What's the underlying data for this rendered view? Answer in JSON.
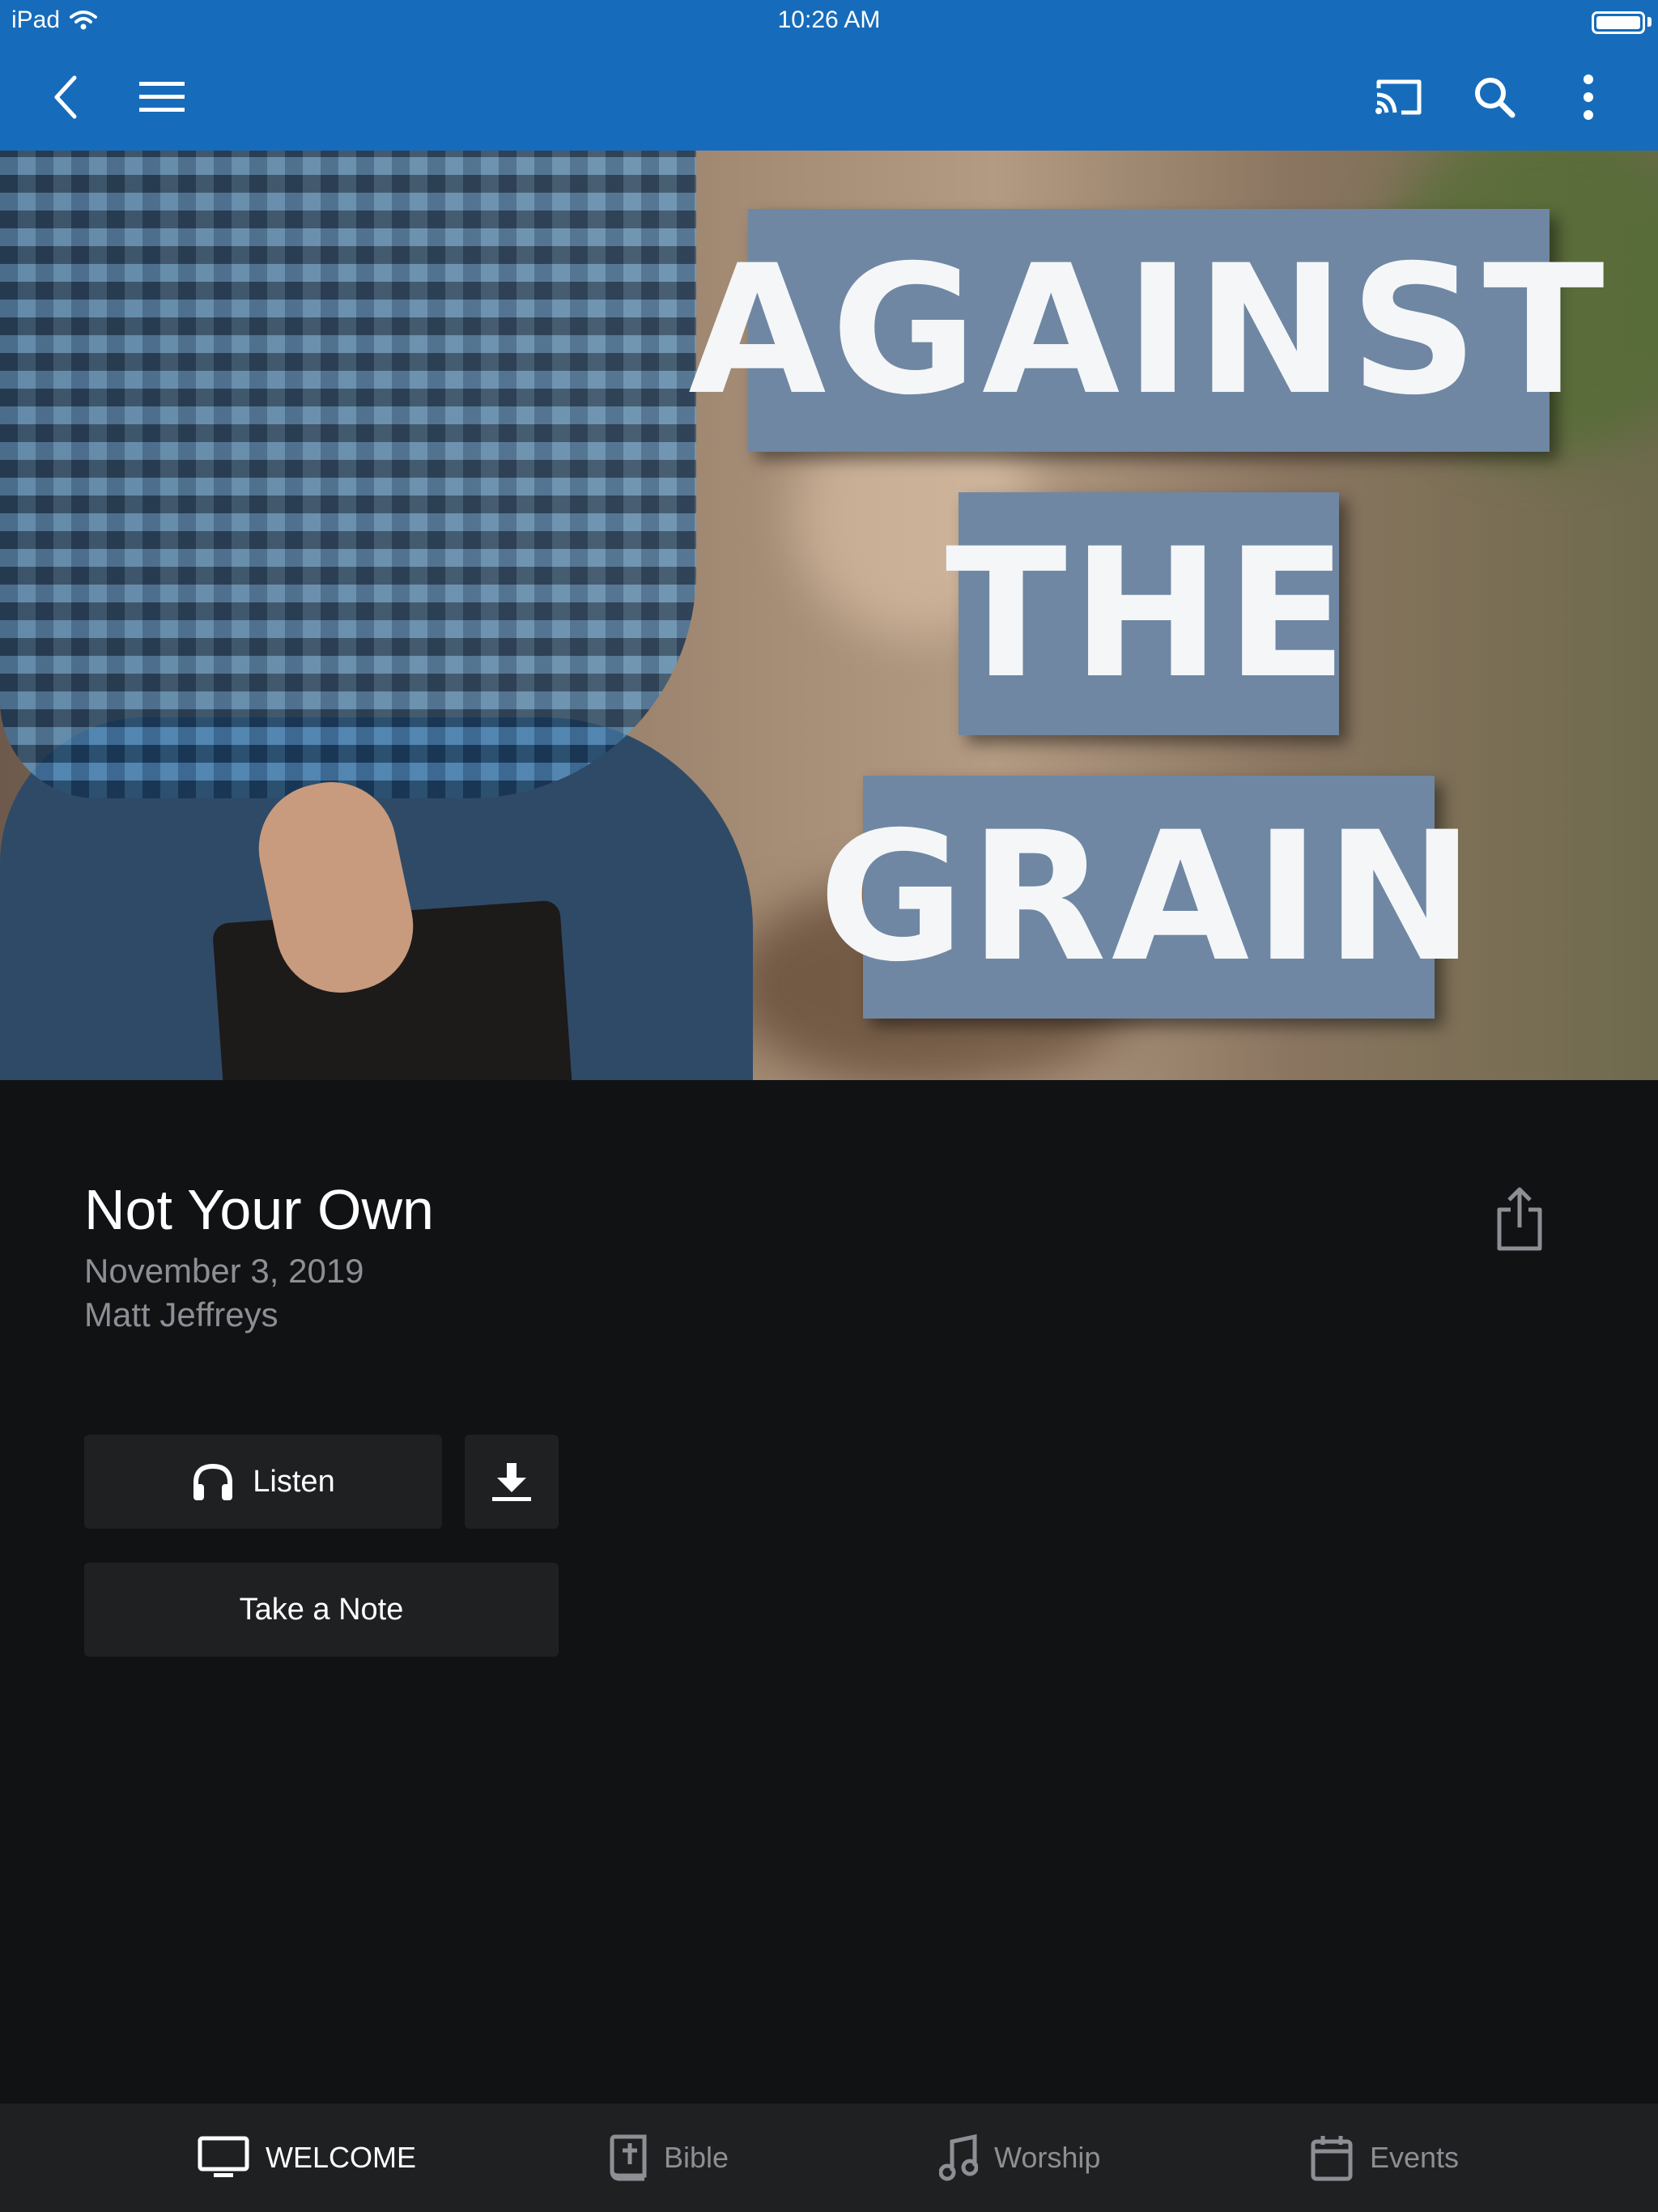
{
  "status_bar": {
    "device": "iPad",
    "time": "10:26 AM"
  },
  "toolbar": {
    "back_icon": "chevron-left-icon",
    "menu_icon": "hamburger-menu-icon",
    "cast_icon": "cast-icon",
    "search_icon": "search-icon",
    "more_icon": "more-vertical-icon"
  },
  "hero": {
    "title_words": [
      "AGAINST",
      "THE",
      "GRAIN"
    ],
    "block_color": "#6f87a3"
  },
  "sermon": {
    "title": "Not Your Own",
    "date": "November 3, 2019",
    "speaker": "Matt Jeffreys"
  },
  "actions": {
    "listen_label": "Listen",
    "note_label": "Take a Note"
  },
  "tabs": [
    {
      "label": "WELCOME",
      "icon": "monitor-icon",
      "active": true
    },
    {
      "label": "Bible",
      "icon": "bible-icon",
      "active": false
    },
    {
      "label": "Worship",
      "icon": "music-note-icon",
      "active": false
    },
    {
      "label": "Events",
      "icon": "calendar-icon",
      "active": false
    }
  ],
  "colors": {
    "accent": "#166cba",
    "background": "#111214",
    "button": "#1f2022",
    "muted_text": "#8d8f94"
  }
}
